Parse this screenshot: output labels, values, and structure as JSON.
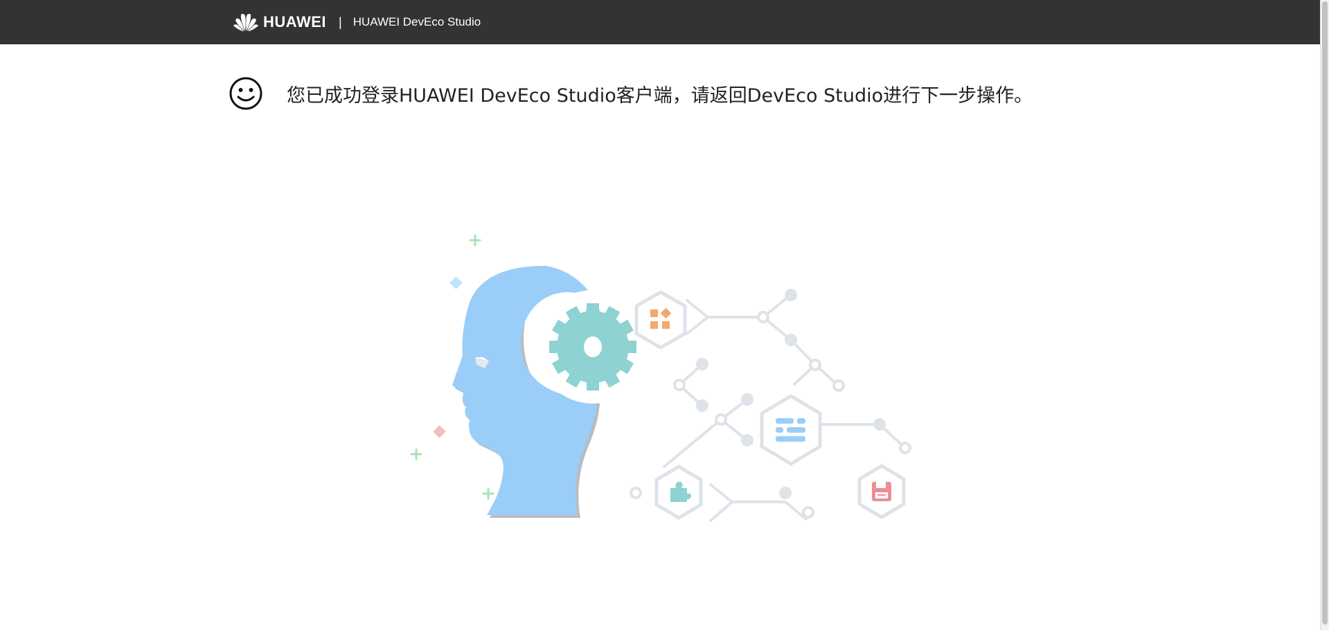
{
  "header": {
    "brand_name": "HUAWEI",
    "divider": "|",
    "product_name": "HUAWEI DevEco Studio"
  },
  "main": {
    "icon": "smiley-icon",
    "message": "您已成功登录HUAWEI DevEco Studio客户端，请返回DevEco Studio进行下一步操作。"
  },
  "illustration": {
    "icons": [
      "head-silhouette-icon",
      "gear-icon",
      "apps-icon",
      "document-icon",
      "puzzle-icon",
      "save-icon"
    ]
  },
  "colors": {
    "topbar": "#333333",
    "head": "#9ACEF8",
    "gear": "#8ED2D2",
    "network": "#DDE3E8",
    "apps": "#F2A86E",
    "save": "#EC8E94"
  }
}
